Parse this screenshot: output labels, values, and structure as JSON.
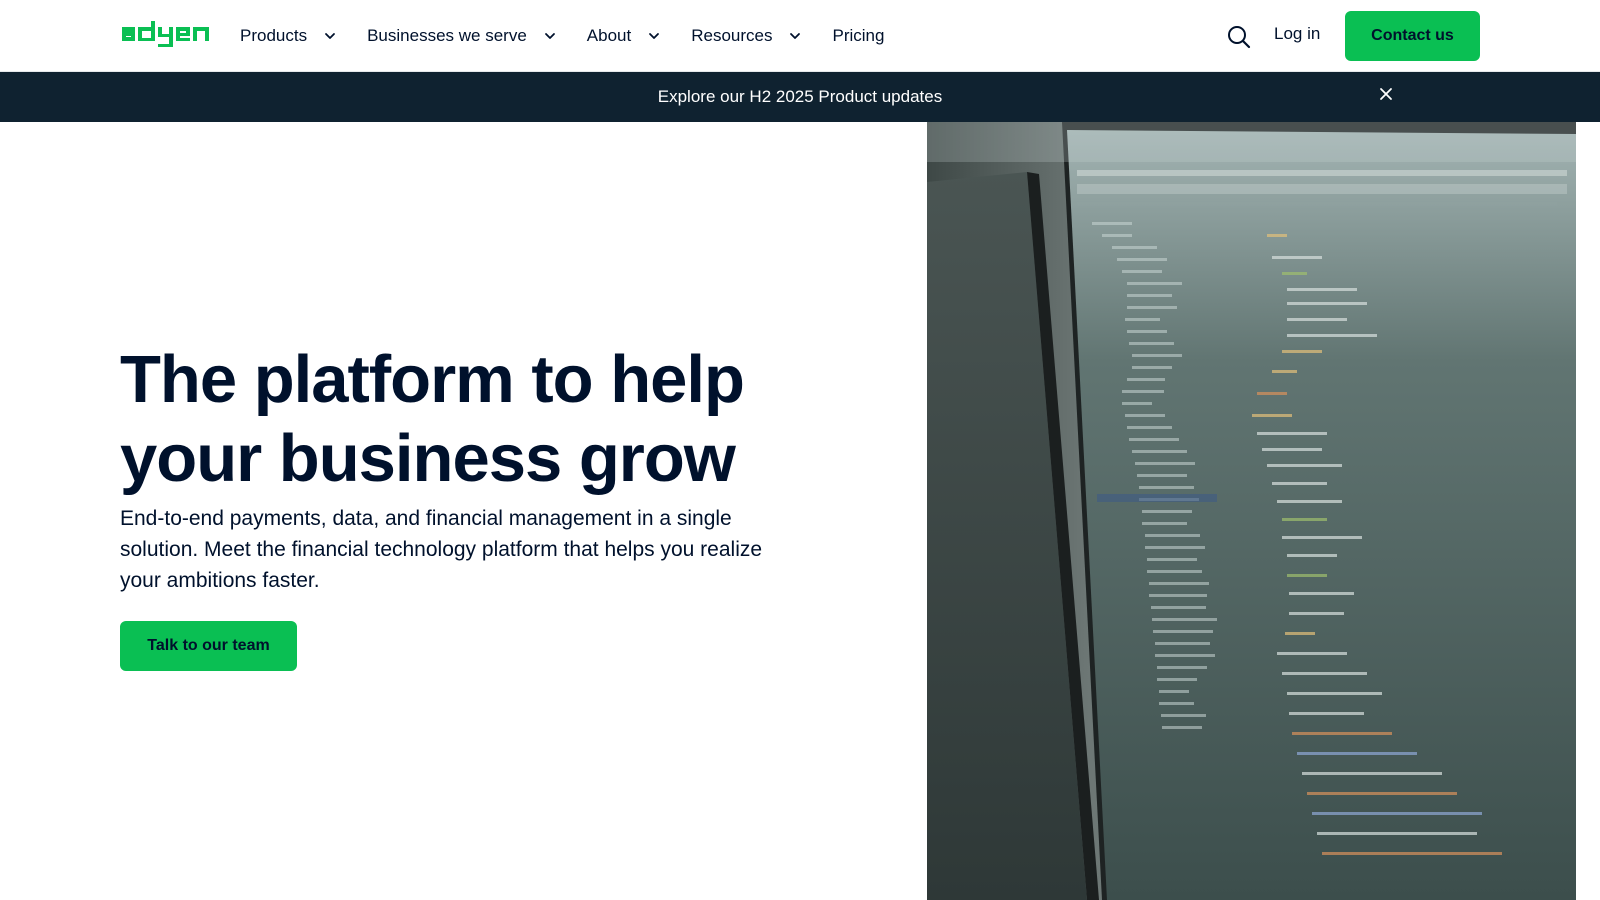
{
  "brand": {
    "name": "adyen",
    "accent": "#0abf53",
    "dark": "#0f2230",
    "text": "#00112c"
  },
  "header": {
    "nav": [
      {
        "label": "Products",
        "has_dropdown": true
      },
      {
        "label": "Businesses we serve",
        "has_dropdown": true
      },
      {
        "label": "About",
        "has_dropdown": true
      },
      {
        "label": "Resources",
        "has_dropdown": true
      },
      {
        "label": "Pricing",
        "has_dropdown": false
      }
    ],
    "search_icon": "search-icon",
    "login_label": "Log in",
    "contact_label": "Contact us"
  },
  "banner": {
    "text": "Explore our H2 2025 Product updates",
    "close_icon": "close-icon"
  },
  "hero": {
    "title_line1": "The platform to help",
    "title_line2": "your business grow",
    "subtitle": "End-to-end payments, data, and financial management in a single solution. Meet the financial technology platform that helps you realize your ambitions faster.",
    "cta_label": "Talk to our team",
    "image": "code-on-monitor-photo"
  }
}
